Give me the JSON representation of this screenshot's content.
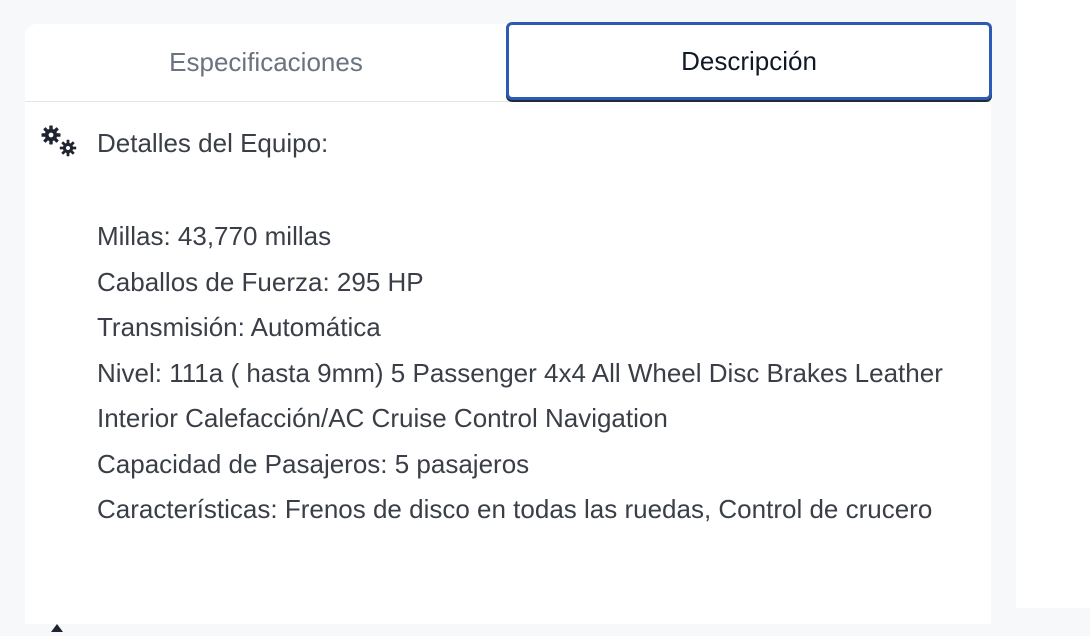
{
  "tabs": [
    {
      "label": "Especificaciones",
      "active": false
    },
    {
      "label": "Descripción",
      "active": true
    }
  ],
  "section": {
    "icon": "gears-icon",
    "title": "Detalles del Equipo:"
  },
  "details": [
    "Millas: 43,770 millas",
    "Caballos de Fuerza: 295 HP",
    "Transmisión: Automática",
    "Nivel: 111a ( hasta 9mm) 5 Passenger 4x4 All Wheel Disc Brakes Leather Interior Calefacción/AC Cruise Control Navigation",
    "Capacidad de Pasajeros: 5 pasajeros",
    "Características: Frenos de disco en todas las ruedas, Control de crucero"
  ],
  "colors": {
    "active_tab_border": "#2c5bb5",
    "text": "#3a3f47",
    "inactive_tab_text": "#6b7280"
  }
}
